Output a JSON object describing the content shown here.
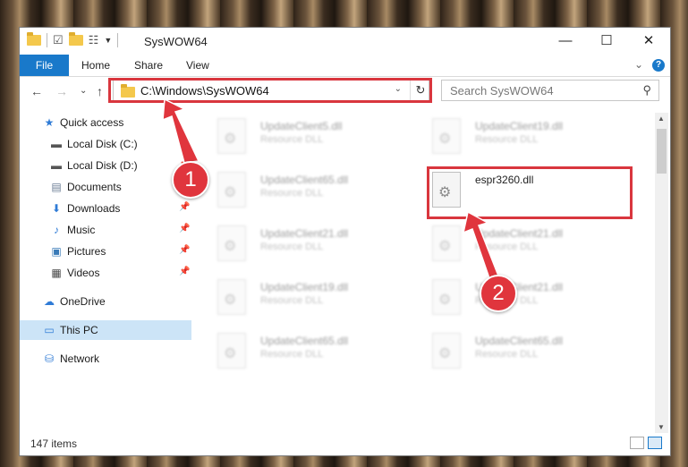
{
  "window": {
    "title": "SysWOW64",
    "minimize": "—",
    "maximize": "☐",
    "close": "✕"
  },
  "ribbon": {
    "file": "File",
    "home": "Home",
    "share": "Share",
    "view": "View",
    "collapse": "⌄",
    "help": "?"
  },
  "nav": {
    "back": "←",
    "forward": "→",
    "recent": "⌄",
    "up": "↑",
    "address": "C:\\Windows\\SysWOW64",
    "address_dropdown": "⌄",
    "refresh": "↻",
    "search_placeholder": "Search SysWOW64",
    "search_icon": "⚲"
  },
  "sidebar": {
    "items": [
      {
        "label": "Quick access",
        "icon": "star-icon",
        "glyph": "★",
        "color": "#2f7bd6",
        "pinned": false
      },
      {
        "label": "Local Disk (C:)",
        "icon": "drive-icon",
        "glyph": "▬",
        "color": "#555555",
        "pinned": true
      },
      {
        "label": "Local Disk (D:)",
        "icon": "drive-icon",
        "glyph": "▬",
        "color": "#555555",
        "pinned": true
      },
      {
        "label": "Documents",
        "icon": "documents-icon",
        "glyph": "▤",
        "color": "#6a7c94",
        "pinned": true
      },
      {
        "label": "Downloads",
        "icon": "download-icon",
        "glyph": "⬇",
        "color": "#2f7bd6",
        "pinned": true
      },
      {
        "label": "Music",
        "icon": "music-icon",
        "glyph": "♪",
        "color": "#2f7bd6",
        "pinned": true
      },
      {
        "label": "Pictures",
        "icon": "pictures-icon",
        "glyph": "▣",
        "color": "#3a7bb8",
        "pinned": true
      },
      {
        "label": "Videos",
        "icon": "videos-icon",
        "glyph": "▦",
        "color": "#444444",
        "pinned": true
      },
      {
        "label": "OneDrive",
        "icon": "cloud-icon",
        "glyph": "☁",
        "color": "#2f7bd6",
        "pinned": false
      },
      {
        "label": "This PC",
        "icon": "computer-icon",
        "glyph": "▭",
        "color": "#2f7bd6",
        "pinned": false
      },
      {
        "label": "Network",
        "icon": "network-icon",
        "glyph": "⛁",
        "color": "#2f7bd6",
        "pinned": false
      }
    ],
    "pin_glyph": "📌"
  },
  "files": {
    "left": [
      {
        "name": "UpdateClient5.dll",
        "type": "Resource DLL"
      },
      {
        "name": "UpdateClient65.dll",
        "type": "Resource DLL"
      },
      {
        "name": "UpdateClient21.dll",
        "type": "Resource DLL"
      },
      {
        "name": "UpdateClient19.dll",
        "type": "Resource DLL"
      },
      {
        "name": "UpdateClient65.dll",
        "type": "Resource DLL"
      }
    ],
    "right": [
      {
        "name": "UpdateClient19.dll",
        "type": "Resource DLL"
      },
      {
        "name": "espr3260.dll",
        "type": ""
      },
      {
        "name": "UpdateClient21.dll",
        "type": "Resource DLL"
      },
      {
        "name": "UpdateClient21.dll",
        "type": "Resource DLL"
      },
      {
        "name": "UpdateClient65.dll",
        "type": "Resource DLL"
      }
    ]
  },
  "status": {
    "count": "147 items"
  },
  "callouts": {
    "one": "1",
    "two": "2"
  },
  "colors": {
    "accent": "#1979ca",
    "highlight_red": "#d9363e",
    "selection": "#cce4f7"
  }
}
